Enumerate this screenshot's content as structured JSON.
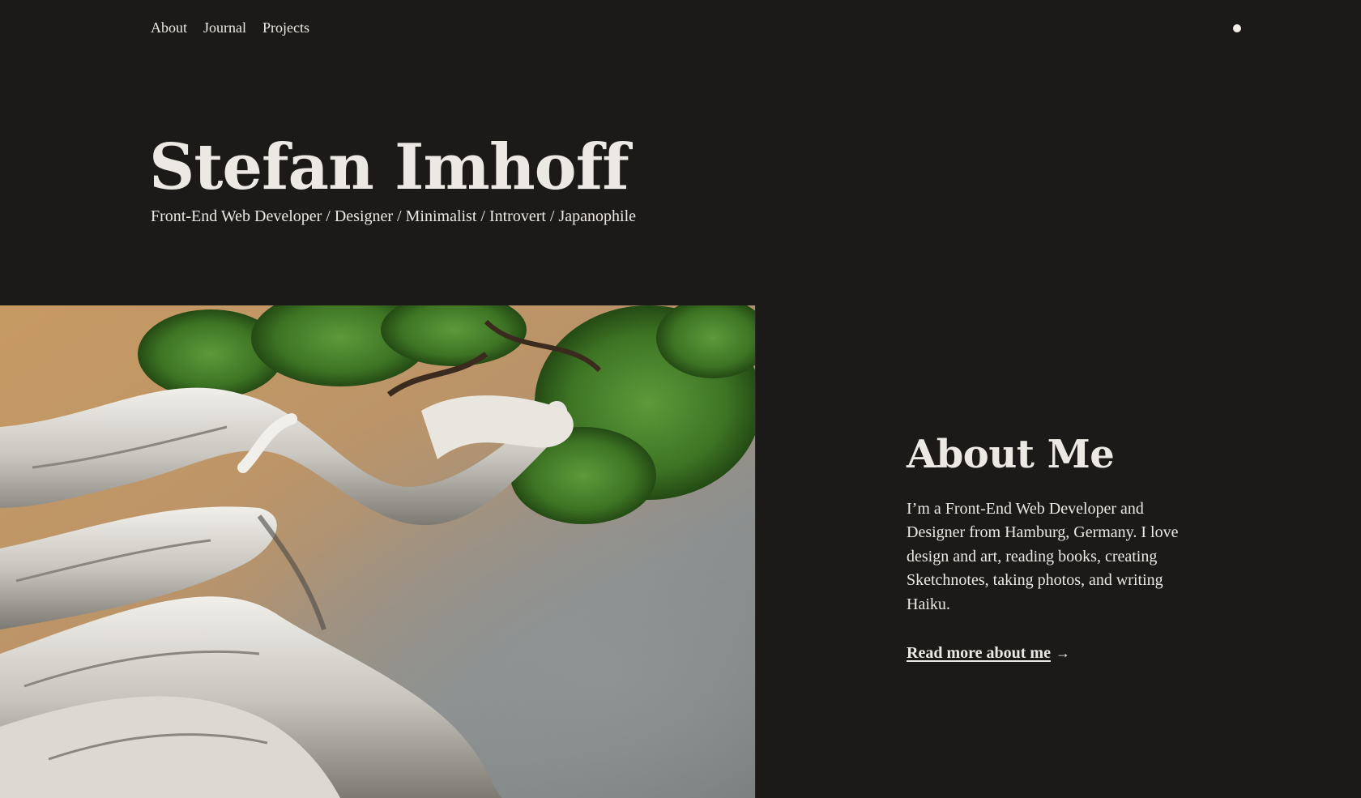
{
  "nav": {
    "items": [
      {
        "label": "About"
      },
      {
        "label": "Journal"
      },
      {
        "label": "Projects"
      }
    ]
  },
  "hero": {
    "title": "Stefan Imhoff",
    "subtitle": "Front-End Web Developer / Designer / Minimalist / Introvert / Japanophile"
  },
  "about": {
    "heading": "About Me",
    "body": "I’m a Front-End Web Developer and Designer from Hamburg, Germany. I love design and art, reading books, creating Sketchnotes, taking photos, and writing Haiku.",
    "link_label": "Read more about me",
    "link_arrow": "→"
  },
  "colors": {
    "background": "#1c1a19",
    "text": "#ece9e4"
  },
  "icons": {
    "theme_toggle": "theme-toggle-dot-icon",
    "arrow": "arrow-right-icon"
  }
}
